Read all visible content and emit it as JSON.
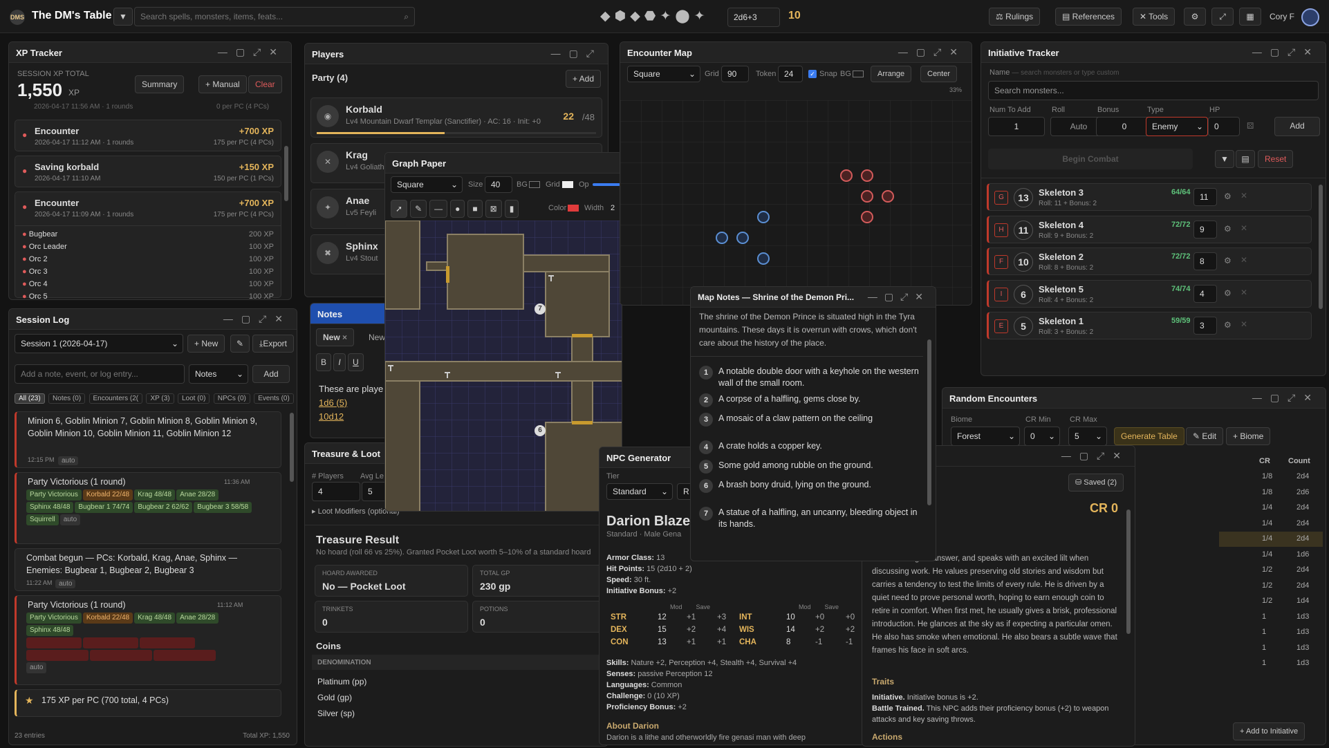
{
  "app": {
    "title": "The DM's Table",
    "logo": "DMS",
    "search_placeholder": "Search spells, monsters, items, feats...",
    "dice_formula": "2d6+3",
    "dice_result": "10",
    "nav": [
      "Rulings",
      "References",
      "Tools"
    ],
    "user": "Cory F"
  },
  "xp": {
    "title": "XP Tracker",
    "total_label": "SESSION XP TOTAL",
    "total": "1,550",
    "unit": "XP",
    "buttons": [
      "Summary",
      "+ Manual",
      "Clear"
    ],
    "top_meta": "2026-04-17 11:56 AM · 1 rounds",
    "top_meta_r": "0 per PC (4 PCs)",
    "entries": [
      {
        "name": "Encounter",
        "xp": "+700 XP",
        "meta": "2026-04-17 11:12 AM · 1 rounds",
        "per": "175 per PC (4 PCs)"
      },
      {
        "name": "Saving korbald",
        "xp": "+150 XP",
        "meta": "2026-04-17 11:10 AM",
        "per": "150 per PC (1 PCs)"
      },
      {
        "name": "Encounter",
        "xp": "+700 XP",
        "meta": "2026-04-17 11:09 AM · 1 rounds",
        "per": "175 per PC (4 PCs)"
      }
    ],
    "kills": [
      {
        "n": "Bugbear",
        "x": "200 XP"
      },
      {
        "n": "Orc Leader",
        "x": "100 XP"
      },
      {
        "n": "Orc 2",
        "x": "100 XP"
      },
      {
        "n": "Orc 3",
        "x": "100 XP"
      },
      {
        "n": "Orc 4",
        "x": "100 XP"
      },
      {
        "n": "Orc 5",
        "x": "100 XP"
      }
    ]
  },
  "log": {
    "title": "Session Log",
    "session": "Session 1 (2026-04-17)",
    "new": "+ New",
    "export": "Export",
    "placeholder": "Add a note, event, or log entry...",
    "type": "Notes",
    "add": "Add",
    "filters": [
      "All (23)",
      "Notes (0)",
      "Encounters (2(",
      "XP (3)",
      "Loot (0)",
      "NPCs (0)",
      "Events (0)"
    ],
    "e1": "Minion 6, Goblin Minion 7, Goblin Minion 8, Goblin Minion 9, Goblin Minion 10, Goblin Minion 11, Goblin Minion 12",
    "e1t": "12:15 PM",
    "auto": "auto",
    "e2": "Party Victorious (1 round)",
    "e2t": "11:36 AM",
    "e2chips": [
      "Party Victorious",
      "Korbald 22/48",
      "Krag 48/48",
      "Anae 28/28",
      "Sphinx 48/48",
      "Bugbear 1 74/74",
      "Bugbear 2 62/62",
      "Bugbear 3 58/58",
      "Squirrell"
    ],
    "e3": "Combat begun — PCs: Korbald, Krag, Anae, Sphinx — Enemies: Bugbear 1, Bugbear 2, Bugbear 3",
    "e3t": "11:22 AM",
    "e4": "Party Victorious (1 round)",
    "e4t": "11:12 AM",
    "e4chips": [
      "Party Victorious",
      "Korbald 22/48",
      "Krag 48/48",
      "Anae 28/28",
      "Sphinx 48/48"
    ],
    "e5": "175 XP per PC (700 total, 4 PCs)",
    "footer_l": "23 entries",
    "footer_r": "Total XP: 1,550"
  },
  "players": {
    "title": "Players",
    "party": "Party (4)",
    "add": "+ Add",
    "list": [
      {
        "name": "Korbald",
        "sub": "Lv4 Mountain Dwarf Templar (Sanctifier) · AC: 16 · Init: +0",
        "hp": "22",
        "max": "/48"
      },
      {
        "name": "Krag",
        "sub": "Lv4 Goliath"
      },
      {
        "name": "Anae",
        "sub": "Lv5 Feyli"
      },
      {
        "name": "Sphinx",
        "sub": "Lv4 Stout"
      }
    ]
  },
  "graph": {
    "title": "Graph Paper",
    "grid": "Square",
    "size_l": "Size",
    "size": "40",
    "bg": "BG",
    "gridl": "Grid",
    "op": "Op",
    "color": "Color",
    "width_l": "Width",
    "width": "2",
    "markers": [
      "7",
      "6"
    ]
  },
  "notes": {
    "title": "Notes",
    "tab": "New",
    "tab2": "New",
    "text": "These are playe",
    "r1": "1d6",
    "r1v": "(5)",
    "r2": "10d12"
  },
  "treasure": {
    "title": "Treasure & Loot",
    "players_l": "# Players",
    "players": "4",
    "avg_l": "Avg Le",
    "avg": "5",
    "mods": "Loot Modifiers (optional)",
    "result": "Treasure Result",
    "desc": "No hoard (roll 66 vs 25%). Granted Pocket Loot worth 5–10% of a standard hoard",
    "hoard_l": "HOARD AWARDED",
    "hoard": "No — Pocket Loot",
    "gp_l": "TOTAL GP",
    "gp": "230 gp",
    "trinkets_l": "TRINKETS",
    "trinkets": "0",
    "potions_l": "POTIONS",
    "potions": "0",
    "coins": "Coins",
    "denom": "DENOMINATION",
    "coin_rows": [
      "Platinum (pp)",
      "Gold (gp)",
      "Silver (sp)"
    ]
  },
  "map": {
    "title": "Encounter Map",
    "grid": "Square",
    "grid_l": "Grid",
    "grid_v": "90",
    "token_l": "Token",
    "token_v": "24",
    "snap": "Snap",
    "bg": "BG",
    "arrange": "Arrange",
    "center": "Center",
    "zoom": "33%"
  },
  "notesmap": {
    "title": "Map Notes — Shrine of the Demon Pri...",
    "intro": "The shrine of the Demon Prince is situated high in the Tyra mountains. These days it is overrun with crows, which don't care about the history of the place.",
    "items": [
      "A notable double door with a keyhole on the western wall of the small room.",
      "A corpse of a halfling, gems close by.",
      "A mosaic of a claw pattern on the ceiling",
      "A crate holds a copper key.",
      "Some gold among rubble on the ground.",
      "A brash bony druid, lying on the ground.",
      "A statue of a halfling, an uncanny, bleeding object in its hands."
    ]
  },
  "npc": {
    "title": "NPC Generator",
    "tier_l": "Tier",
    "tier": "Standard",
    "race": "R",
    "name": "Darion Blaze",
    "sub": "Standard · Male Gena",
    "ac": "13",
    "hp": "15 (2d10 + 2)",
    "speed": "30 ft.",
    "init": "+2",
    "stats": [
      [
        "STR",
        "12",
        "+1",
        "+3"
      ],
      [
        "DEX",
        "15",
        "+2",
        "+4"
      ],
      [
        "CON",
        "13",
        "+1",
        "+1"
      ],
      [
        "INT",
        "10",
        "+0",
        "+0"
      ],
      [
        "WIS",
        "14",
        "+2",
        "+2"
      ],
      [
        "CHA",
        "8",
        "-1",
        "-1"
      ]
    ],
    "skills": "Nature +2, Perception +4, Stealth +4, Survival +4",
    "senses": "passive Perception 12",
    "languages": "Common",
    "challenge": "0 (10 XP)",
    "prof": "+2",
    "about": "About Darion",
    "about_t": "Darion is a lithe and otherworldly fire genasi man with deep",
    "cr": "CR 0",
    "saved": "Saved (2)",
    "desc": "n considering an answer, and speaks with an excited lilt when discussing work. He values preserving old stories and wisdom but carries a tendency to test the limits of every rule. He is driven by a quiet need to prove personal worth, hoping to earn enough coin to retire in comfort. When first met, he usually gives a brisk, professional introduction. He glances at the sky as if expecting a particular omen. He also has smoke when emotional. He also bears a subtle wave that frames his face in soft arcs.",
    "traits": "Traits",
    "t1b": "Initiative.",
    "t1": "Initiative bonus is +2.",
    "t2b": "Battle Trained.",
    "t2": "This NPC adds their proficiency bonus (+2) to weapon attacks and key saving throws.",
    "actions": "Actions"
  },
  "init": {
    "title": "Initiative Tracker",
    "name_l": "Name",
    "name_hint": "— search monsters or type custom",
    "search": "Search monsters...",
    "num_l": "Num To Add",
    "num": "1",
    "roll_l": "Roll",
    "roll": "Auto",
    "bonus_l": "Bonus",
    "bonus": "0",
    "type_l": "Type",
    "type": "Enemy",
    "hp_l": "HP",
    "hp": "0",
    "add": "Add",
    "begin": "Begin Combat",
    "reset": "Reset",
    "list": [
      {
        "tag": "G",
        "init": "13",
        "name": "Skeleton 3",
        "roll": "Roll: 11 + Bonus: 2",
        "hp": "64/64",
        "ac": "11"
      },
      {
        "tag": "H",
        "init": "11",
        "name": "Skeleton 4",
        "roll": "Roll: 9 + Bonus: 2",
        "hp": "72/72",
        "ac": "9"
      },
      {
        "tag": "F",
        "init": "10",
        "name": "Skeleton 2",
        "roll": "Roll: 8 + Bonus: 2",
        "hp": "72/72",
        "ac": "8"
      },
      {
        "tag": "I",
        "init": "6",
        "name": "Skeleton 5",
        "roll": "Roll: 4 + Bonus: 2",
        "hp": "74/74",
        "ac": "4"
      },
      {
        "tag": "E",
        "init": "5",
        "name": "Skeleton 1",
        "roll": "Roll: 3 + Bonus: 2",
        "hp": "59/59",
        "ac": "3"
      }
    ]
  },
  "rand": {
    "title": "Random Encounters",
    "biome_l": "Biome",
    "biome": "Forest",
    "crmin_l": "CR Min",
    "crmin": "0",
    "crmax_l": "CR Max",
    "crmax": "5",
    "gen": "Generate Table",
    "edit": "Edit",
    "add_biome": "+ Biome",
    "cr_h": "CR",
    "count_h": "Count",
    "rows": [
      [
        "1/8",
        "2d4"
      ],
      [
        "1/8",
        "2d6"
      ],
      [
        "1/4",
        "2d4"
      ],
      [
        "1/4",
        "2d4"
      ],
      [
        "1/4",
        "2d4"
      ],
      [
        "1/4",
        "1d6"
      ],
      [
        "1/2",
        "2d4"
      ],
      [
        "1/2",
        "2d4"
      ],
      [
        "1/2",
        "1d4"
      ],
      [
        "1",
        "1d3"
      ],
      [
        "1",
        "1d3"
      ],
      [
        "1",
        "1d3"
      ],
      [
        "1",
        "1d3"
      ]
    ],
    "add_init": "+ Add to Initiative"
  }
}
